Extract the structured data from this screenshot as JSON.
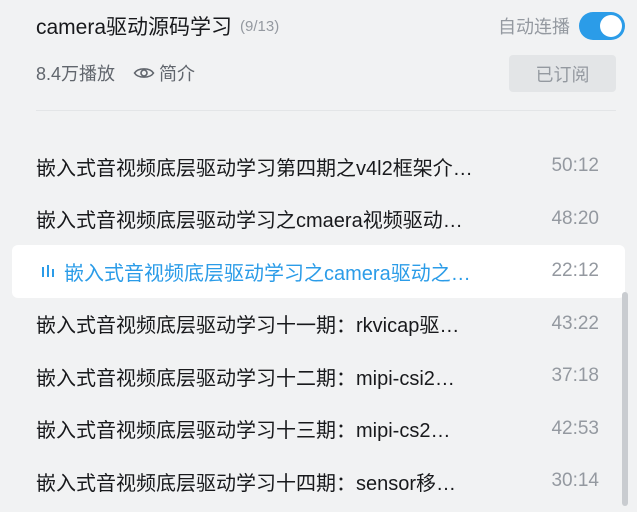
{
  "header": {
    "title": "camera驱动源码学习",
    "count": "(9/13)",
    "autoplay_label": "自动连播",
    "autoplay_on": true,
    "views": "8.4万播放",
    "intro_label": "简介",
    "subscribe_label": "已订阅"
  },
  "colors": {
    "accent": "#2b9ce8",
    "text": "#18191c",
    "muted": "#9499a0",
    "background": "#f1f2f3"
  },
  "episodes": [
    {
      "title": "嵌入式音视频底层驱动学习第四期之v4l2框架介…",
      "duration": "50:12",
      "active": false
    },
    {
      "title": "嵌入式音视频底层驱动学习之cmaera视频驱动…",
      "duration": "48:20",
      "active": false
    },
    {
      "title": "嵌入式音视频底层驱动学习之camera驱动之…",
      "duration": "22:12",
      "active": true
    },
    {
      "title": "嵌入式音视频底层驱动学习十一期：rkvicap驱…",
      "duration": "43:22",
      "active": false
    },
    {
      "title": "嵌入式音视频底层驱动学习十二期：mipi-csi2…",
      "duration": "37:18",
      "active": false
    },
    {
      "title": "嵌入式音视频底层驱动学习十三期：mipi-cs2…",
      "duration": "42:53",
      "active": false
    },
    {
      "title": "嵌入式音视频底层驱动学习十四期：sensor移…",
      "duration": "30:14",
      "active": false
    }
  ]
}
